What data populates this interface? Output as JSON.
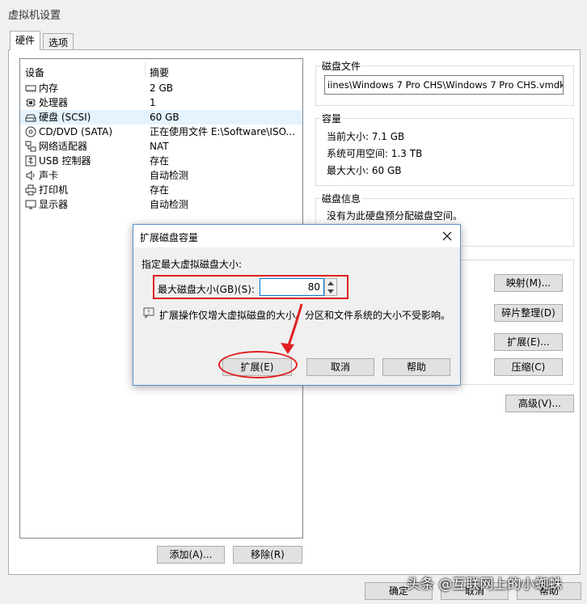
{
  "window": {
    "title": "虚拟机设置"
  },
  "tabs": [
    {
      "label": "硬件"
    },
    {
      "label": "选项"
    }
  ],
  "device_list": {
    "headers": {
      "device": "设备",
      "summary": "摘要"
    },
    "rows": [
      {
        "icon": "memory-icon",
        "name": "内存",
        "summary": "2 GB"
      },
      {
        "icon": "processor-icon",
        "name": "处理器",
        "summary": "1"
      },
      {
        "icon": "hard-disk-icon",
        "name": "硬盘 (SCSI)",
        "summary": "60 GB"
      },
      {
        "icon": "cd-dvd-icon",
        "name": "CD/DVD (SATA)",
        "summary": "正在使用文件 E:\\Software\\ISO..."
      },
      {
        "icon": "network-adapter-icon",
        "name": "网络适配器",
        "summary": "NAT"
      },
      {
        "icon": "usb-controller-icon",
        "name": "USB 控制器",
        "summary": "存在"
      },
      {
        "icon": "sound-card-icon",
        "name": "声卡",
        "summary": "自动检测"
      },
      {
        "icon": "printer-icon",
        "name": "打印机",
        "summary": "存在"
      },
      {
        "icon": "display-icon",
        "name": "显示器",
        "summary": "自动检测"
      }
    ],
    "selected_index": 2
  },
  "buttons": {
    "add": "添加(A)...",
    "remove": "移除(R)",
    "ok": "确定",
    "cancel": "取消",
    "help": "帮助"
  },
  "disk_file": {
    "label": "磁盘文件",
    "value": "iines\\Windows 7 Pro CHS\\Windows 7 Pro CHS.vmdk"
  },
  "capacity": {
    "label": "容量",
    "current_size": "当前大小: 7.1 GB",
    "available": "系统可用空间: 1.3 TB",
    "max_size": "最大大小: 60 GB"
  },
  "disk_info": {
    "label": "磁盘信息",
    "text": "没有为此硬盘预分配磁盘空间。"
  },
  "utilities": {
    "map": "映射(M)...",
    "defrag": "碎片整理(D)",
    "expand": "扩展(E)...",
    "compact": "压缩(C)",
    "advanced": "高级(V)..."
  },
  "dialog": {
    "title": "扩展磁盘容量",
    "instruction": "指定最大虚拟磁盘大小:",
    "field_label": "最大磁盘大小(GB)(S):",
    "field_value": "80",
    "note": "扩展操作仅增大虚拟磁盘的大小。分区和文件系统的大小不受影响。",
    "expand_button": "扩展(E)",
    "cancel_button": "取消",
    "help_button": "帮助"
  },
  "watermark": "头条 @互联网上的小蜘蛛",
  "colors": {
    "annotation_red": "#e02020",
    "selection": "#e5f3ff",
    "dialog_border": "#5e8fc9"
  }
}
